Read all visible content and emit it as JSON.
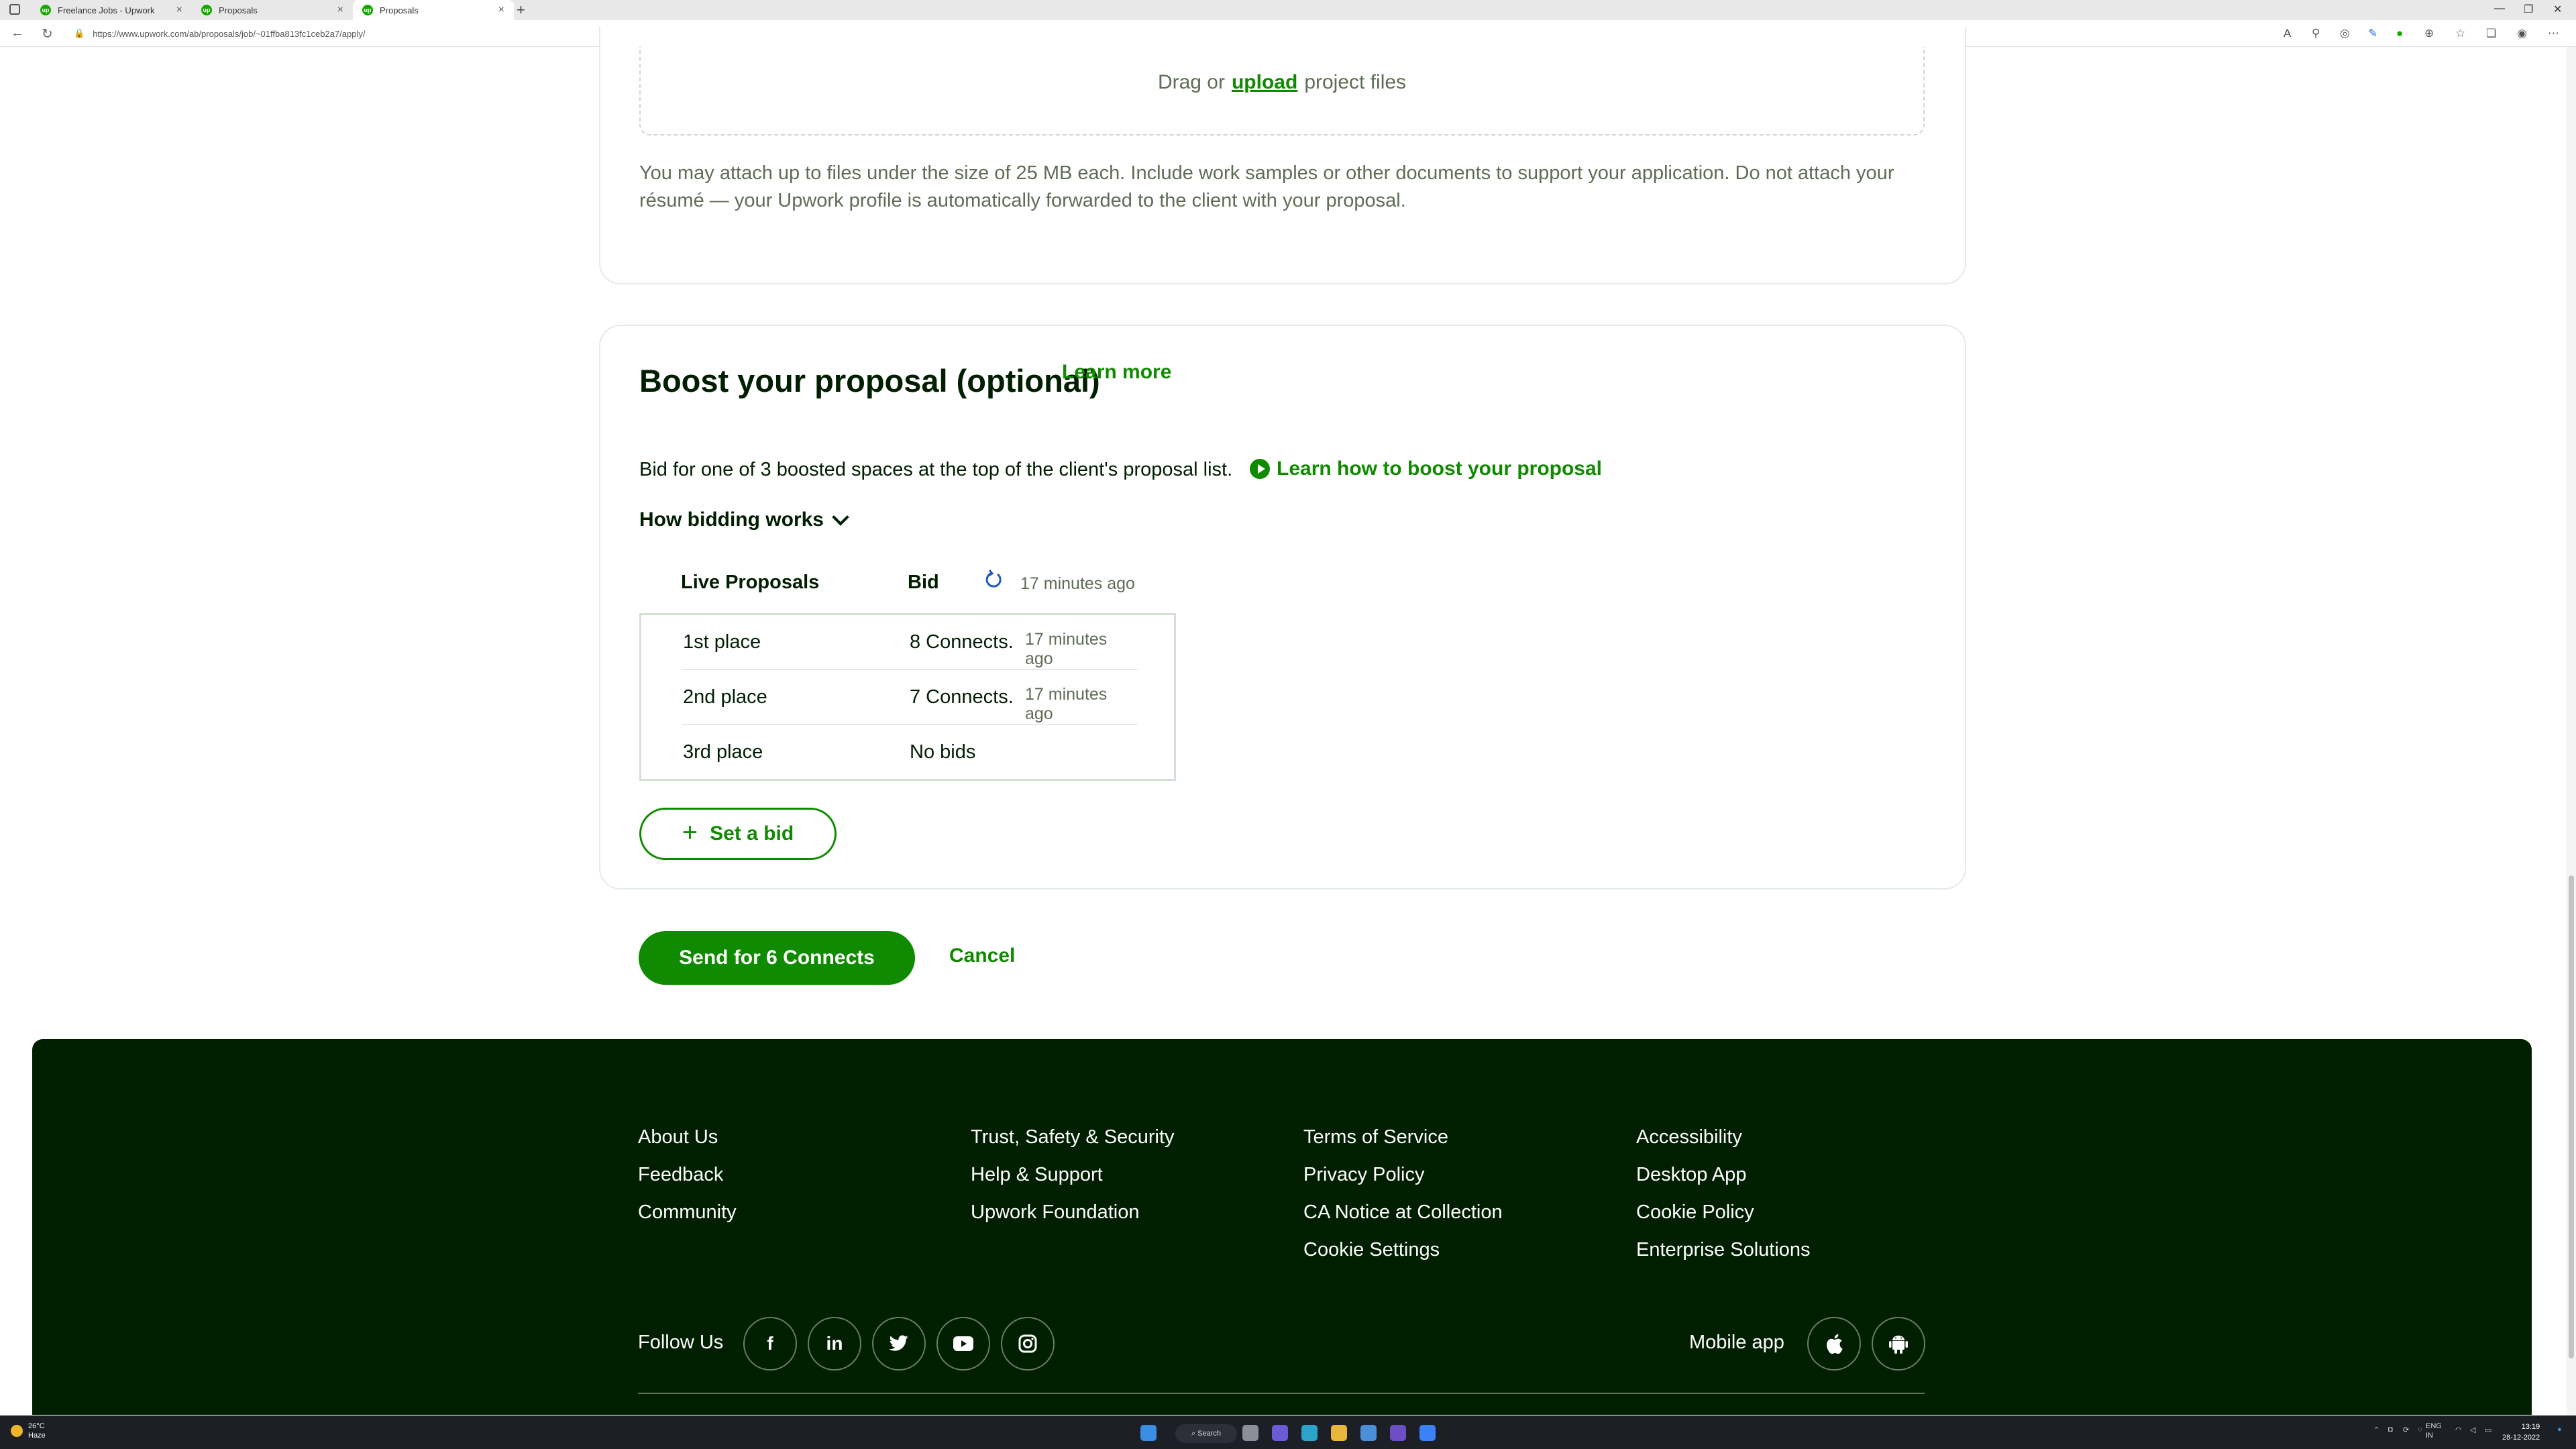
{
  "browser": {
    "tabs": [
      {
        "label": "Freelance Jobs - Upwork"
      },
      {
        "label": "Proposals"
      },
      {
        "label": "Proposals"
      }
    ],
    "url": "https://www.upwork.com/ab/proposals/job/~01ffba813fc1ceb2a7/apply/"
  },
  "attachments": {
    "drag_prefix": "Drag or",
    "upload_link": "upload",
    "drag_suffix": "project files",
    "note": "You may attach up to files under the size of 25 MB each. Include work samples or other documents to support your application. Do not attach your résumé — your Upwork profile is automatically forwarded to the client with your proposal."
  },
  "boost": {
    "title": "Boost your proposal (optional)",
    "learn_more": "Learn more",
    "description": "Bid for one of 3 boosted spaces at the top of the client's proposal list.",
    "learn_boost": "Learn how to boost your proposal",
    "how_bidding": "How bidding works",
    "table": {
      "col_live": "Live Proposals",
      "col_bid": "Bid",
      "updated": "17 minutes ago",
      "rows": [
        {
          "place": "1st place",
          "bid": "8 Connects.",
          "time": "17 minutes ago"
        },
        {
          "place": "2nd place",
          "bid": "7 Connects.",
          "time": "17 minutes ago"
        },
        {
          "place": "3rd place",
          "bid": "No bids",
          "time": ""
        }
      ]
    },
    "set_bid": "Set a bid"
  },
  "actions": {
    "send": "Send for 6 Connects",
    "cancel": "Cancel"
  },
  "footer": {
    "col1": [
      "About Us",
      "Feedback",
      "Community"
    ],
    "col2": [
      "Trust, Safety & Security",
      "Help & Support",
      "Upwork Foundation"
    ],
    "col3": [
      "Terms of Service",
      "Privacy Policy",
      "CA Notice at Collection",
      "Cookie Settings"
    ],
    "col4": [
      "Accessibility",
      "Desktop App",
      "Cookie Policy",
      "Enterprise Solutions"
    ],
    "follow_us": "Follow Us",
    "mobile_app": "Mobile app"
  },
  "taskbar": {
    "weather_temp": "26°C",
    "weather_cond": "Haze",
    "search": "Search",
    "lang1": "ENG",
    "lang2": "IN",
    "time": "13:19",
    "date": "28-12-2022"
  },
  "colors": {
    "brand_green": "#108a00",
    "footer_bg": "#001e00"
  }
}
